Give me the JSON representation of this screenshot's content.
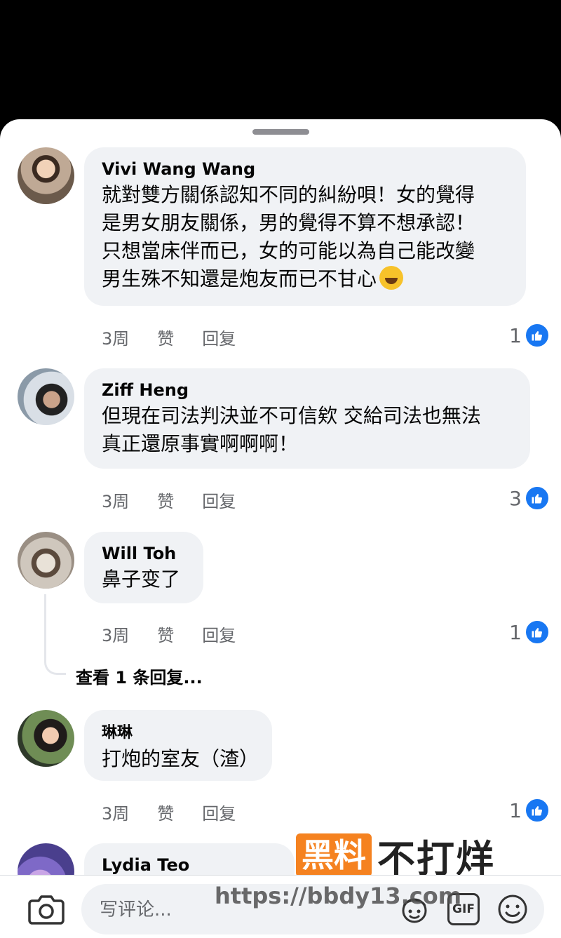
{
  "comments": [
    {
      "name": "Vivi Wang Wang",
      "lines": [
        "就對雙方關係認知不同的糾紛唄！女的覺得",
        "是男女朋友關係，男的覺得不算不想承認！",
        "只想當床伴而已，女的可能以為自己能改變",
        "男生殊不知還是炮友而已不甘心"
      ],
      "emoji": "rolling-on-floor-laughing",
      "time": "3周",
      "like_label": "赞",
      "reply_label": "回复",
      "likes": "1"
    },
    {
      "name": "Ziff Heng",
      "lines": [
        "但現在司法判決並不可信欸 交給司法也無法",
        "真正還原事實啊啊啊！"
      ],
      "time": "3周",
      "like_label": "赞",
      "reply_label": "回复",
      "likes": "3"
    },
    {
      "name": "Will Toh",
      "lines": [
        "鼻子变了"
      ],
      "time": "3周",
      "like_label": "赞",
      "reply_label": "回复",
      "likes": "1",
      "view_replies": "查看 1 条回复..."
    },
    {
      "name": "琳琳",
      "lines": [
        "打炮的室友（渣）"
      ],
      "time": "3周",
      "like_label": "赞",
      "reply_label": "回复",
      "likes": "1"
    },
    {
      "name": "Lydia Teo"
    }
  ],
  "composer": {
    "placeholder": "写评论...",
    "gif_label": "GIF"
  },
  "watermark": {
    "box_text": "黑料",
    "text": "不打烊",
    "url": "https://bbdy13.com"
  },
  "colors": {
    "like_blue": "#1877f2",
    "bubble_bg": "#f0f2f5",
    "meta_gray": "#65676b",
    "watermark_orange": "#f58220"
  }
}
